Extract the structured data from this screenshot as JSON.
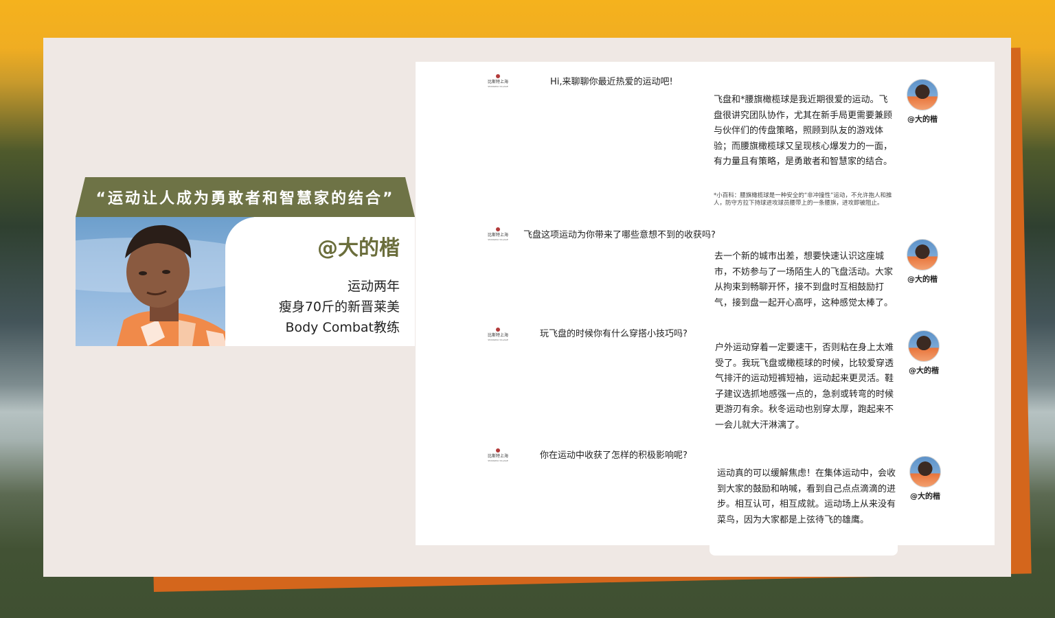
{
  "colors": {
    "accent_olive": "#6e7346",
    "name_olive": "#6b6e3c",
    "orange": "#d4661c",
    "card_bg": "#efe8e4"
  },
  "profile": {
    "quote": "“运动让人成为勇敢者和智慧家的结合”",
    "handle": "@大的楷",
    "lines": [
      "运动两年",
      "瘦身70斤的新晋莱美",
      "Body Combat教练"
    ],
    "photo": "portrait-photo"
  },
  "logo": {
    "cn": "比斯特上海",
    "en": "SHANGHAI VILLAGE",
    "icon": "brand-logo-icon"
  },
  "chat": {
    "q1": "Hi,来聊聊你最近热爱的运动吧!",
    "a1": "飞盘和*腰旗橄榄球是我近期很爱的运动。飞盘很讲究团队协作，尤其在新手局更需要兼顾与伙伴们的传盘策略，照顾到队友的游戏体验；而腰旗橄榄球又呈现核心爆发力的一面，有力量且有策略，是勇敢者和智慧家的结合。",
    "note": "*小百科：腰旗橄榄球是一种安全的“非冲撞性”运动，不允许抱人和推人，防守方拉下持球进攻球员腰带上的一条腰旗，进攻即被阻止。",
    "q2": "飞盘这项运动为你带来了哪些意想不到的收获吗?",
    "a2": "去一个新的城市出差，想要快速认识这座城市，不妨参与了一场陌生人的飞盘活动。大家从拘束到畅聊开怀，接不到盘时互相鼓励打气，接到盘一起开心高呼，这种感觉太棒了。",
    "q3": "玩飞盘的时候你有什么穿搭小技巧吗?",
    "a3": "户外运动穿着一定要速干，否则粘在身上太难受了。我玩飞盘或橄榄球的时候，比较爱穿透气排汗的运动短裤短袖，运动起来更灵活。鞋子建议选抓地感强一点的，急刹或转弯的时候更游刃有余。秋冬运动也别穿太厚，跑起来不一会儿就大汗淋漓了。",
    "q4": "你在运动中收获了怎样的积极影响呢?",
    "a4": "运动真的可以缓解焦虑！在集体运动中，会收到大家的鼓励和呐喊，看到自己点点滴滴的进步。相互认可，相互成就。运动场上从来没有菜鸟，因为大家都是上弦待飞的雄鹰。",
    "avatar_name": "@大的楷"
  }
}
